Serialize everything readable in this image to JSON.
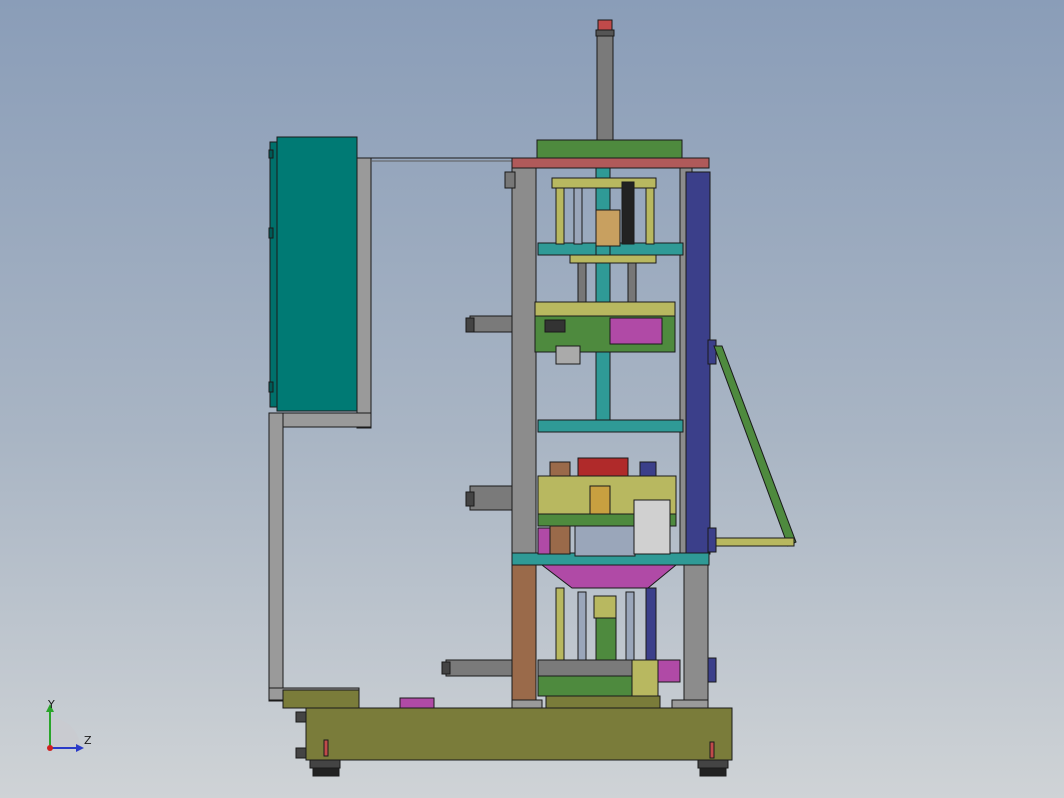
{
  "viewport": {
    "background_top": "#8a9db8",
    "background_bottom": "#cfd3d6"
  },
  "model": {
    "parts": [
      "control-cabinet",
      "cabinet-support-bracket",
      "frame-left-column",
      "frame-right-column",
      "top-plate",
      "vertical-cylinder",
      "upper-press-station",
      "lower-press-station",
      "bottom-press-station",
      "side-brace-arm",
      "base-platform",
      "leveling-feet"
    ],
    "colors": {
      "cabinet": "#007a74",
      "frame_steel": "#8c8c8c",
      "column_blue": "#3b3f8a",
      "brace_green": "#4e8a3e",
      "base_olive": "#7a7c3a",
      "plate_red": "#b05a5a",
      "magenta": "#b04aa6",
      "teal": "#2f9a96",
      "yellow_green": "#b8b860"
    }
  },
  "triad": {
    "y_label": "Y",
    "z_label": "Z",
    "y_color": "#2aa52a",
    "z_color": "#2a3ac8",
    "x_color": "#d02020"
  }
}
